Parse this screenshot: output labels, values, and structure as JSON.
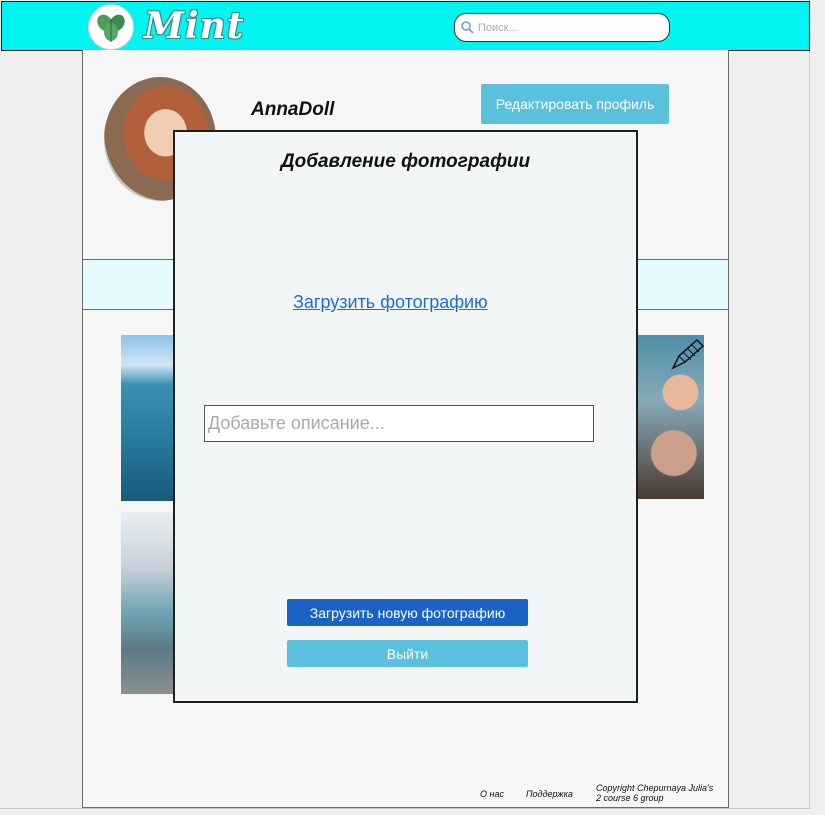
{
  "header": {
    "logo_text": "Mint",
    "search_placeholder": "Поиск..."
  },
  "profile": {
    "username": "AnnaDoll",
    "edit_button": "Редактировать профиль"
  },
  "modal": {
    "title": "Добавление фотографии",
    "upload_link": "Загрузить фотографию",
    "description_placeholder": "Добавьте описание...",
    "upload_button": "Загрузить новую фотографию",
    "exit_button": "Выйти"
  },
  "footer": {
    "about": "О нас",
    "support": "Поддержка",
    "copyright_line1": "Copyright Chepurnaya Julia's",
    "copyright_line2": "2 course 6 group"
  },
  "colors": {
    "header_bg": "#00f4f0",
    "accent_light": "#5bc0de",
    "accent_dark": "#1a62c4",
    "tabbar_bg": "#e5fbff"
  },
  "icons": [
    "mint-leaf-icon",
    "search-icon",
    "pencil-icon"
  ]
}
